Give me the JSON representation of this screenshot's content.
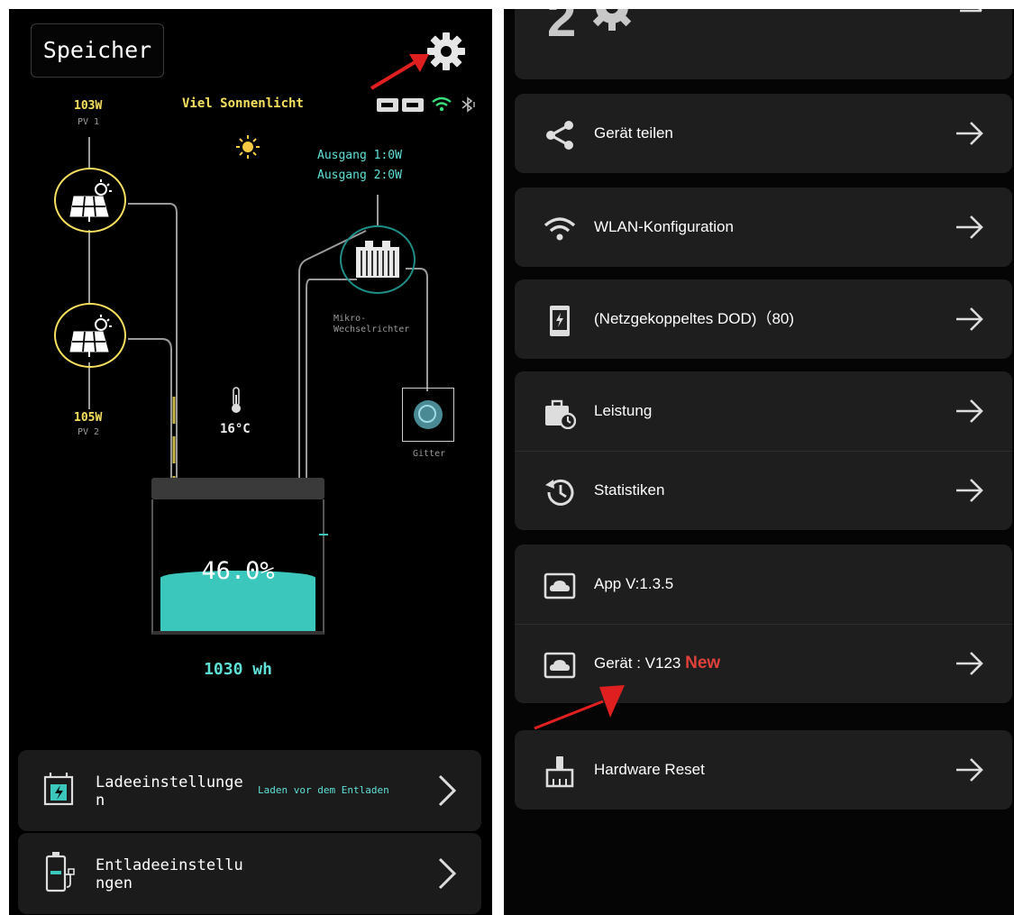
{
  "left": {
    "title": "Speicher",
    "weather": "Viel Sonnenlicht",
    "pv1": {
      "power": "103W",
      "name": "PV 1"
    },
    "pv2": {
      "power": "105W",
      "name": "PV 2"
    },
    "outputs": [
      "Ausgang 1:0W",
      "Ausgang 2:0W"
    ],
    "inverter_label": "Mikro-\nWechselrichter",
    "grid_label": "Gitter",
    "temperature": "16°C",
    "battery_percent": "46.0%",
    "battery_level": 0.46,
    "energy": "1030 wh",
    "cards": [
      {
        "label": "Ladeeinstellunge\nn",
        "sub": "Laden vor dem Entladen"
      },
      {
        "label": "Entladeeinstellu\nngen",
        "sub": ""
      }
    ],
    "colors": {
      "yellow": "#f6e05e",
      "teal": "#3cc7bd",
      "annotation": "#e02020"
    }
  },
  "right": {
    "top_partial_text": "2",
    "items": [
      {
        "label": "Gerät teilen",
        "icon": "share-icon",
        "arrow": true
      },
      {
        "label": "WLAN-Konfiguration",
        "icon": "wifi-icon",
        "arrow": true
      },
      {
        "label": "(Netzgekoppeltes DOD)（80)",
        "icon": "phone-bolt-icon",
        "arrow": true
      },
      {
        "label": "Leistung",
        "icon": "briefcase-clock-icon",
        "arrow": true
      },
      {
        "label": "Statistiken",
        "icon": "history-icon",
        "arrow": true
      },
      {
        "label": "App V:1.3.5",
        "icon": "cloud-icon",
        "arrow": false
      },
      {
        "label": "Gerät : V123",
        "badge": "New",
        "icon": "cloud-icon",
        "arrow": true
      },
      {
        "label": "Hardware Reset",
        "icon": "broom-icon",
        "arrow": true
      }
    ],
    "badge_color": "#e0413a"
  }
}
